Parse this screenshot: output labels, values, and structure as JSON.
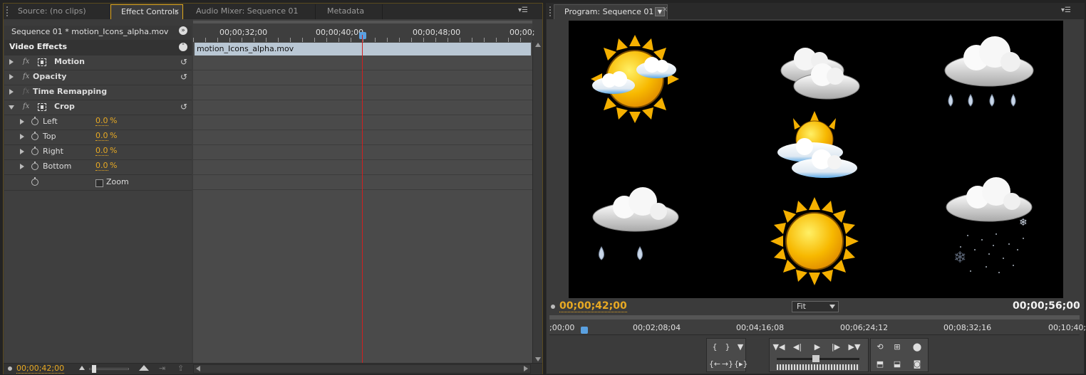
{
  "left_panel": {
    "tabs": [
      {
        "label": "Source: (no clips)"
      },
      {
        "label": "Effect Controls"
      },
      {
        "label": "Audio Mixer: Sequence 01"
      },
      {
        "label": "Metadata"
      }
    ],
    "close_glyph": "×",
    "sequence_label": "Sequence 01 * motion_Icons_alpha.mov",
    "video_effects_label": "Video Effects",
    "effects": [
      {
        "name": "Motion"
      },
      {
        "name": "Opacity"
      },
      {
        "name": "Time Remapping"
      },
      {
        "name": "Crop"
      }
    ],
    "crop_params": [
      {
        "name": "Left",
        "value": "0.0",
        "unit": "%"
      },
      {
        "name": "Top",
        "value": "0.0",
        "unit": "%"
      },
      {
        "name": "Right",
        "value": "0.0",
        "unit": "%"
      },
      {
        "name": "Bottom",
        "value": "0.0",
        "unit": "%"
      }
    ],
    "zoom_label": "Zoom",
    "fx_glyph": "fx",
    "reset_glyph": "↺",
    "ruler_labels": [
      "00;00;32;00",
      "00;00;40;00",
      "00;00;48;00",
      "00;00;"
    ],
    "clip_name": "motion_Icons_alpha.mov",
    "bottom_timecode": "00;00;42;00"
  },
  "right_panel": {
    "tab_label": "Program: Sequence 01",
    "current_timecode": "00;00;42;00",
    "duration_timecode": "00;00;56;00",
    "zoom_select": "Fit",
    "ruler_labels": [
      ";00;00",
      "00;02;08;04",
      "00;04;16;08",
      "00;06;24;12",
      "00;08;32;16",
      "00;10;40;"
    ],
    "accent_color": "#e8a923"
  }
}
